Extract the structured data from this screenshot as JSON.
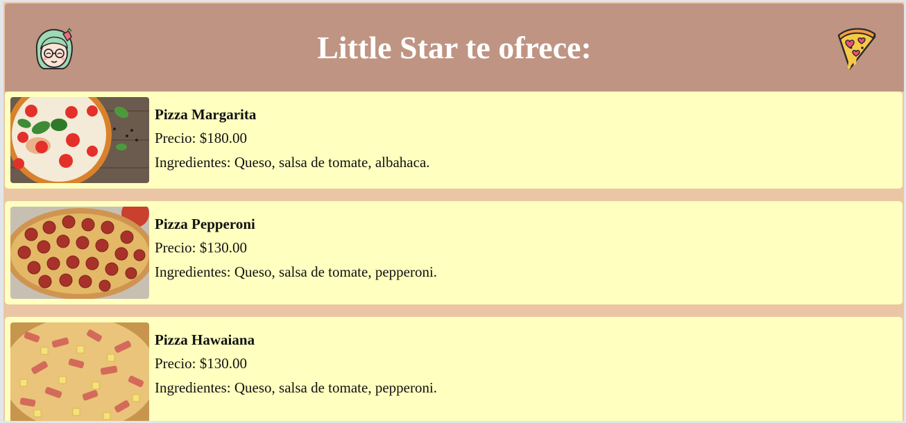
{
  "header": {
    "title": "Little Star te ofrece:",
    "left_logo_icon": "anime-girl-avatar-icon",
    "right_logo_icon": "pizza-slice-hearts-icon"
  },
  "products": [
    {
      "name": "Pizza Margarita",
      "price": "Precio: $180.00",
      "ingredients": "Ingredientes: Queso, salsa de tomate, albahaca.",
      "image": "pizza-margarita-image"
    },
    {
      "name": "Pizza Pepperoni",
      "price": "Precio: $130.00",
      "ingredients": "Ingredientes: Queso, salsa de tomate, pepperoni.",
      "image": "pizza-pepperoni-image"
    },
    {
      "name": "Pizza Hawaiana",
      "price": "Precio: $130.00",
      "ingredients": "Ingredientes: Queso, salsa de tomate, pepperoni.",
      "image": "pizza-hawaiana-image"
    }
  ],
  "colors": {
    "header": "#bf9482",
    "page": "#ebc6a4",
    "card": "#ffffc0",
    "title": "#ffffff"
  }
}
